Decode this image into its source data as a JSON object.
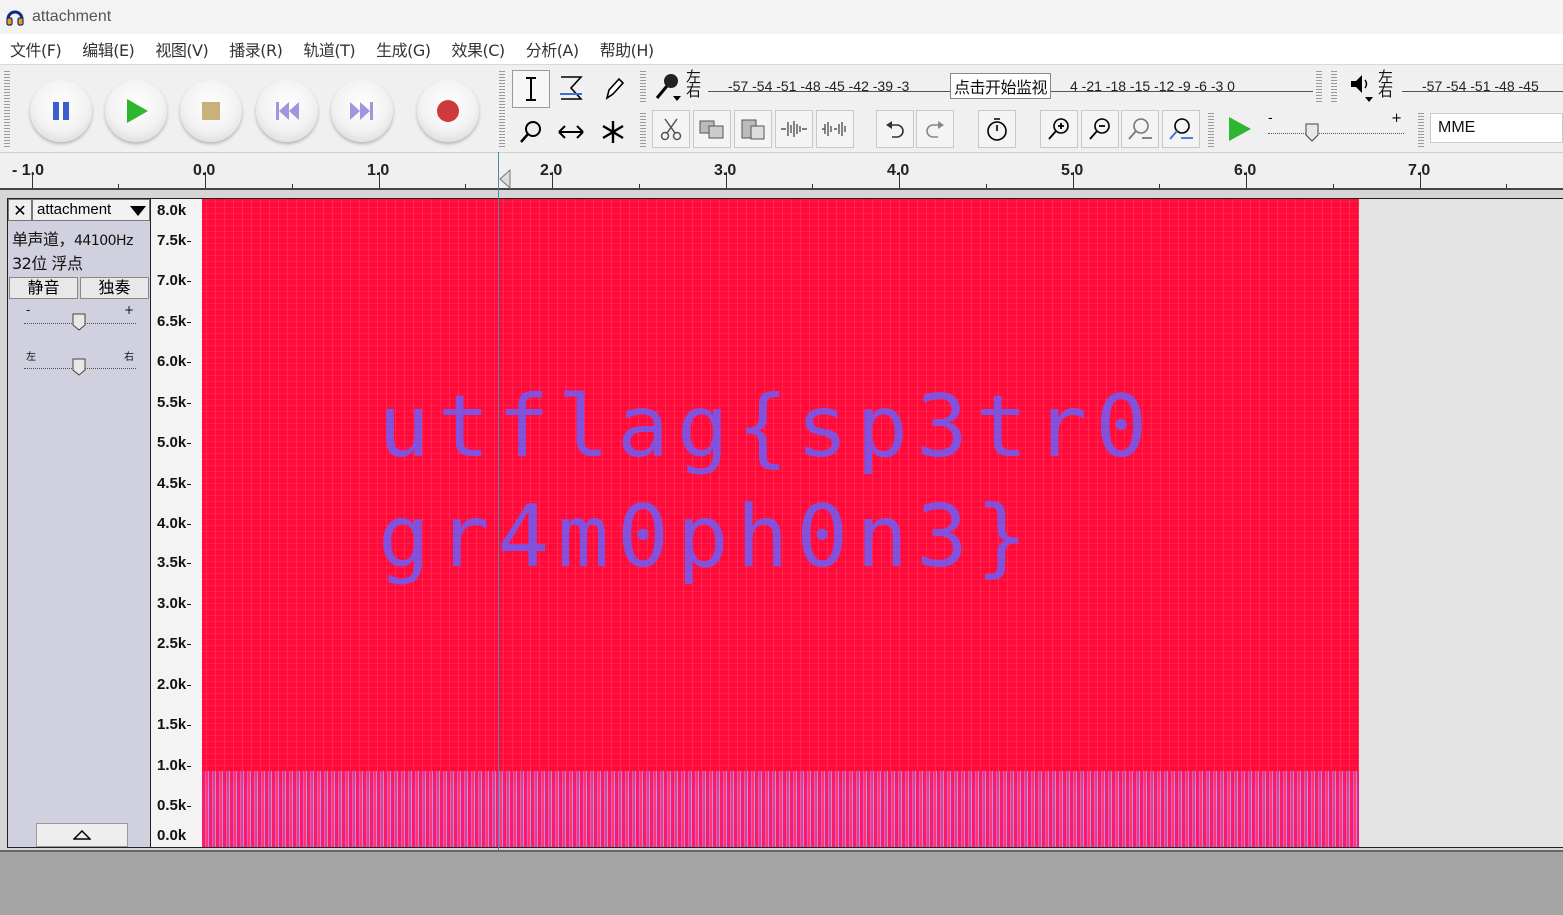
{
  "window": {
    "title": "attachment"
  },
  "menu": [
    "文件(F)",
    "编辑(E)",
    "视图(V)",
    "播录(R)",
    "轨道(T)",
    "生成(G)",
    "效果(C)",
    "分析(A)",
    "帮助(H)"
  ],
  "transport": {
    "buttons": [
      "pause",
      "play",
      "stop",
      "skip-start",
      "skip-end",
      "record"
    ]
  },
  "meters": {
    "record_lr_top": "左",
    "record_lr_bottom": "右",
    "record_scale": "-57 -54 -51 -48 -45 -42 -39 -3",
    "record_scale_right": "4 -21 -18 -15 -12  -9  -6  -3  0",
    "monitor_label": "点击开始监视",
    "play_lr_top": "左",
    "play_lr_bottom": "右",
    "play_scale": "-57 -54 -51 -48 -45"
  },
  "playback_speed": {
    "minus": "-",
    "plus": "+"
  },
  "host": "MME",
  "ruler": {
    "labels": [
      "- 1.0",
      "0.0",
      "1.0",
      "2.0",
      "3.0",
      "4.0",
      "5.0",
      "6.0",
      "7.0"
    ]
  },
  "track": {
    "name": "attachment",
    "info_line1": "单声道，",
    "info_rate": "44100Hz",
    "info_line2": "32位 浮点",
    "mute": "静音",
    "solo": "独奏",
    "gain_minus": "-",
    "gain_plus": "+",
    "pan_left": "左",
    "pan_right": "右"
  },
  "vruler": {
    "labels": [
      "8.0k",
      "7.5k",
      "7.0k",
      "6.5k",
      "6.0k",
      "5.5k",
      "5.0k",
      "4.5k",
      "4.0k",
      "3.5k",
      "3.0k",
      "2.5k",
      "2.0k",
      "1.5k",
      "1.0k",
      "0.5k",
      "0.0k"
    ]
  },
  "spectrogram": {
    "line1": "utflag{sp3tr0",
    "line2": "gr4m0ph0n3}",
    "colors": {
      "background": "#ff0a3a",
      "text": "#6a60ff"
    }
  }
}
